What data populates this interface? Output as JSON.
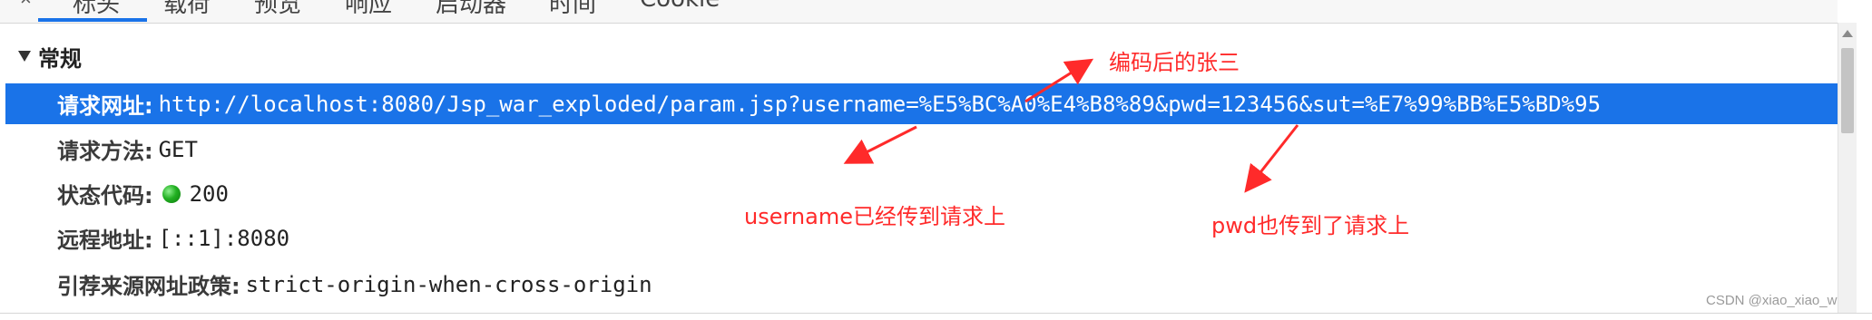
{
  "tabs": {
    "close_glyph": "×",
    "items": [
      {
        "label": "标头",
        "active": true
      },
      {
        "label": "载荷"
      },
      {
        "label": "预览"
      },
      {
        "label": "响应"
      },
      {
        "label": "启动器"
      },
      {
        "label": "时间"
      },
      {
        "label": "Cookie"
      }
    ]
  },
  "general": {
    "title": "常规",
    "request_url_label": "请求网址:",
    "request_url_value": "http://localhost:8080/Jsp_war_exploded/param.jsp?username=%E5%BC%A0%E4%B8%89&pwd=123456&sut=%E7%99%BB%E5%BD%95",
    "method_label": "请求方法:",
    "method_value": "GET",
    "status_label": "状态代码:",
    "status_value": "200",
    "remote_label": "远程地址:",
    "remote_value": "[::1]:8080",
    "referrer_label": "引荐来源网址政策:",
    "referrer_value": "strict-origin-when-cross-origin"
  },
  "annotations": {
    "encoded_name": "编码后的张三",
    "username_note": "username已经传到请求上",
    "pwd_note": "pwd也传到了请求上",
    "color": "#ff2a2a"
  },
  "colors": {
    "selected_row": "#1a73e8",
    "status_ok": "#22b022"
  },
  "watermark": "CSDN @xiao_xiao_w"
}
